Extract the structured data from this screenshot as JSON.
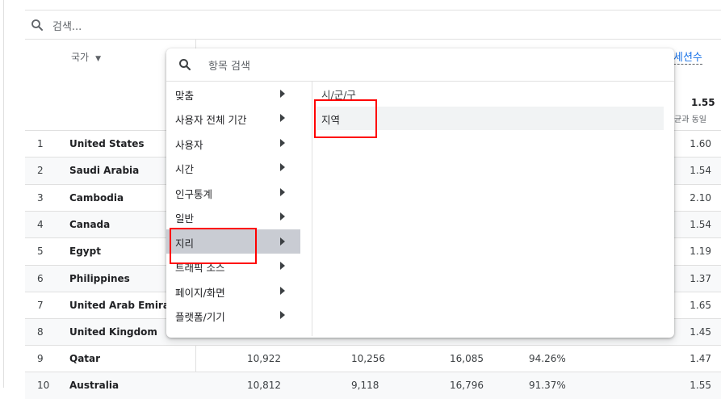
{
  "search": {
    "placeholder": "검색..."
  },
  "table": {
    "country_header": "국가",
    "right_header": "세션수",
    "total_value": "1.55",
    "total_sub": "균과 동일",
    "rows": [
      {
        "rank": "1",
        "country": "United States",
        "c1": "",
        "c2": "",
        "c3": "",
        "c4": "",
        "last": "1.60"
      },
      {
        "rank": "2",
        "country": "Saudi Arabia",
        "c1": "",
        "c2": "",
        "c3": "",
        "c4": "",
        "last": "1.54"
      },
      {
        "rank": "3",
        "country": "Cambodia",
        "c1": "",
        "c2": "",
        "c3": "",
        "c4": "",
        "last": "2.10"
      },
      {
        "rank": "4",
        "country": "Canada",
        "c1": "",
        "c2": "",
        "c3": "",
        "c4": "",
        "last": "1.54"
      },
      {
        "rank": "5",
        "country": "Egypt",
        "c1": "",
        "c2": "",
        "c3": "",
        "c4": "",
        "last": "1.19"
      },
      {
        "rank": "6",
        "country": "Philippines",
        "c1": "",
        "c2": "",
        "c3": "",
        "c4": "",
        "last": "1.37"
      },
      {
        "rank": "7",
        "country": "United Arab Emirates",
        "c1": "",
        "c2": "",
        "c3": "",
        "c4": "",
        "last": "1.65"
      },
      {
        "rank": "8",
        "country": "United Kingdom",
        "c1": "",
        "c2": "",
        "c3": "",
        "c4": "",
        "last": "1.45"
      },
      {
        "rank": "9",
        "country": "Qatar",
        "c1": "10,922",
        "c2": "10,256",
        "c3": "16,085",
        "c4": "94.26%",
        "last": "1.47"
      },
      {
        "rank": "10",
        "country": "Australia",
        "c1": "10,812",
        "c2": "9,118",
        "c3": "16,796",
        "c4": "91.37%",
        "last": "1.55"
      }
    ]
  },
  "popup": {
    "search_placeholder": "항목 검색",
    "categories": [
      {
        "label": "맞춤"
      },
      {
        "label": "사용자 전체 기간"
      },
      {
        "label": "사용자"
      },
      {
        "label": "시간"
      },
      {
        "label": "인구통계"
      },
      {
        "label": "일반"
      },
      {
        "label": "지리"
      },
      {
        "label": "트래픽 소스"
      },
      {
        "label": "페이지/화면"
      },
      {
        "label": "플랫폼/기기"
      }
    ],
    "selected_category": "지리",
    "subcategory_header": "시/군/구",
    "subcategory_item": "지역"
  },
  "colors": {
    "highlight": "#ff0000",
    "active_category": "#c9ccd3",
    "link": "#1a73e8"
  }
}
